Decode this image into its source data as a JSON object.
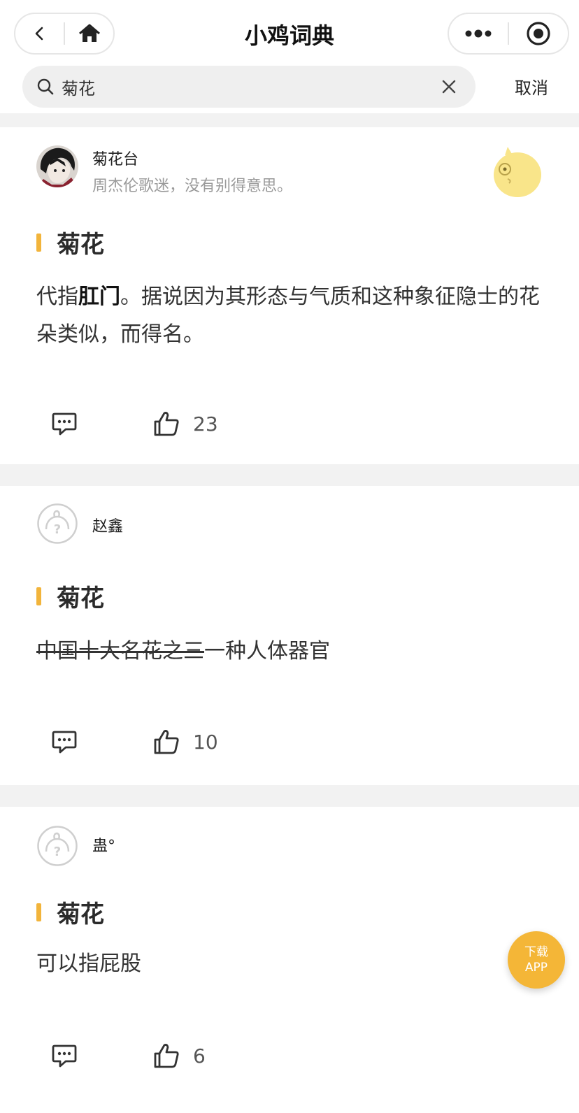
{
  "nav": {
    "title": "小鸡词典"
  },
  "search": {
    "query": "菊花",
    "cancel_label": "取消"
  },
  "entries": [
    {
      "user": "菊花台",
      "bio": "周杰伦歌迷，没有别得意思。",
      "word": "菊花",
      "definition_parts": [
        "代指",
        "肛门",
        "。据说因为其形态与气质和这种象征隐士的花朵类似，而得名。"
      ],
      "likes": "23"
    },
    {
      "user": "赵鑫",
      "word": "菊花",
      "definition_struck": "中国十大名花之三",
      "definition_rest": "一种人体器官",
      "likes": "10"
    },
    {
      "user": "蛊°",
      "word": "菊花",
      "definition": "可以指屁股",
      "likes": "6"
    }
  ],
  "fab": {
    "line1": "下载",
    "line2": "APP"
  },
  "colors": {
    "accent": "#f2b43b",
    "fab": "#f4b637",
    "page_bg": "#f2f2f2"
  }
}
